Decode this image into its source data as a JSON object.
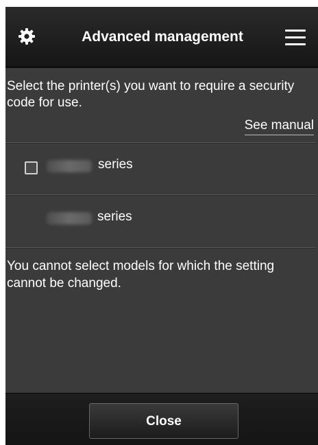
{
  "header": {
    "title": "Advanced management",
    "left_icon": "gear-icon",
    "right_icon": "hamburger-menu-icon"
  },
  "instructions": "Select the printer(s) you want to require a security code for use.",
  "see_manual_label": "See manual",
  "printers": [
    {
      "model_blurred": true,
      "suffix": "series",
      "checkbox": true,
      "checked": false
    },
    {
      "model_blurred": true,
      "suffix": "series",
      "checkbox": false,
      "checked": false
    }
  ],
  "note": "You cannot select models for which the setting cannot be changed.",
  "footer": {
    "close_label": "Close"
  },
  "colors": {
    "background": "#3b3b3b",
    "header": "#1a1a1a",
    "text": "#ffffff"
  }
}
